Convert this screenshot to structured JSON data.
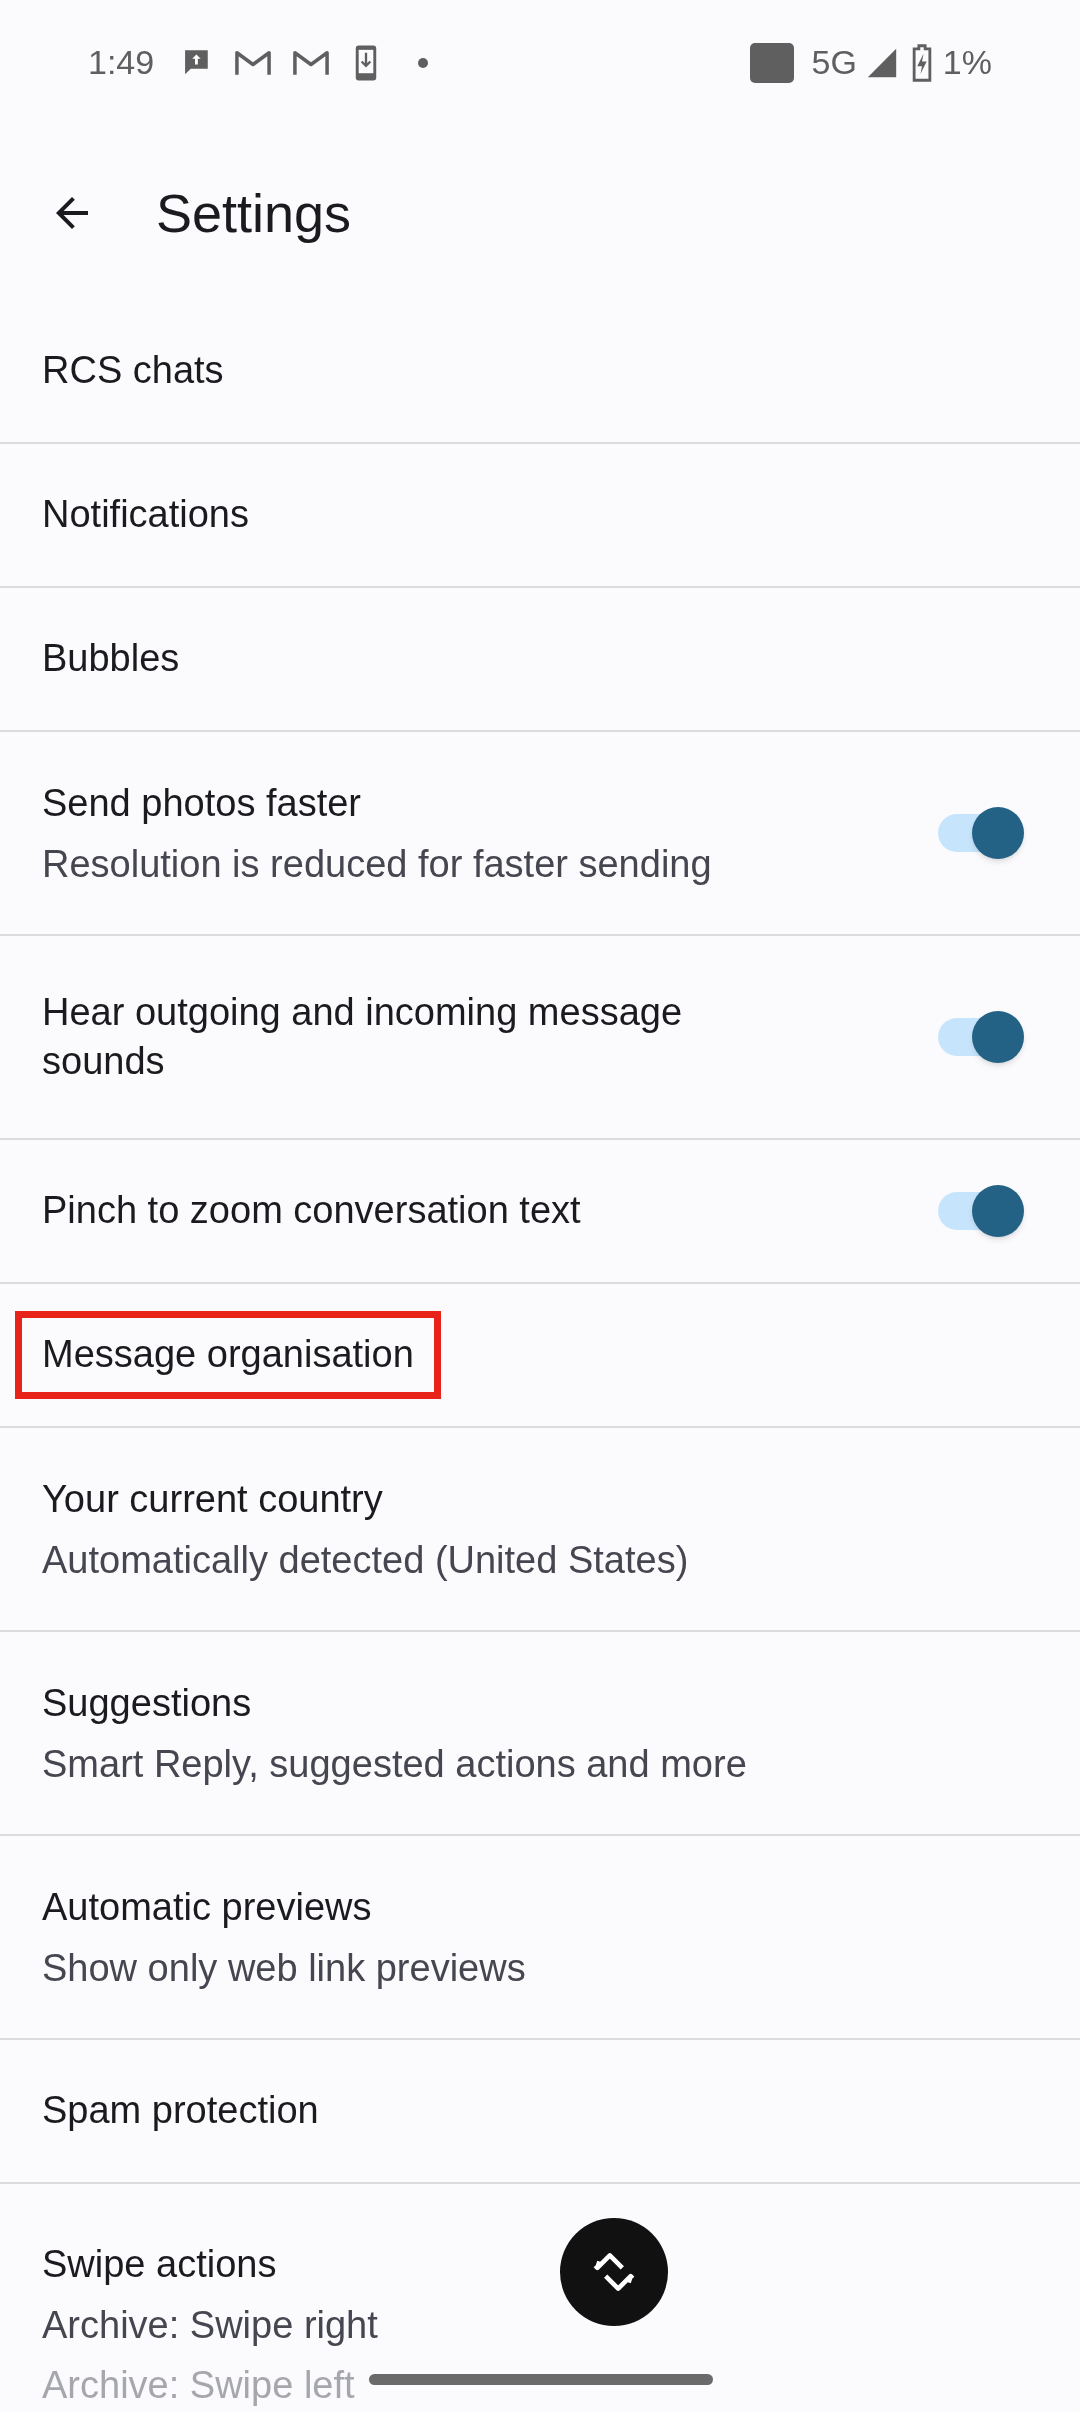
{
  "status_bar": {
    "time": "1:49",
    "network": "5G",
    "battery": "1%"
  },
  "app_bar": {
    "title": "Settings"
  },
  "items": [
    {
      "kind": "link",
      "title": "RCS chats"
    },
    {
      "kind": "link",
      "title": "Notifications"
    },
    {
      "kind": "link",
      "title": "Bubbles"
    },
    {
      "kind": "toggle",
      "title": "Send photos faster",
      "subtitle": "Resolution is reduced for faster sending",
      "on": true
    },
    {
      "kind": "toggle",
      "title": "Hear outgoing and incoming message sounds",
      "on": true
    },
    {
      "kind": "toggle",
      "title": "Pinch to zoom conversation text",
      "on": true
    },
    {
      "kind": "link",
      "title": "Message organisation",
      "highlighted": true
    },
    {
      "kind": "link",
      "title": "Your current country",
      "subtitle": "Automatically detected (United States)"
    },
    {
      "kind": "link",
      "title": "Suggestions",
      "subtitle": "Smart Reply, suggested actions and more"
    },
    {
      "kind": "link",
      "title": "Automatic previews",
      "subtitle": "Show only web link previews"
    },
    {
      "kind": "link",
      "title": "Spam protection"
    },
    {
      "kind": "link",
      "title": "Swipe actions",
      "subtitle": "Archive: Swipe right",
      "subtitle_2": "Archive: Swipe left"
    }
  ]
}
